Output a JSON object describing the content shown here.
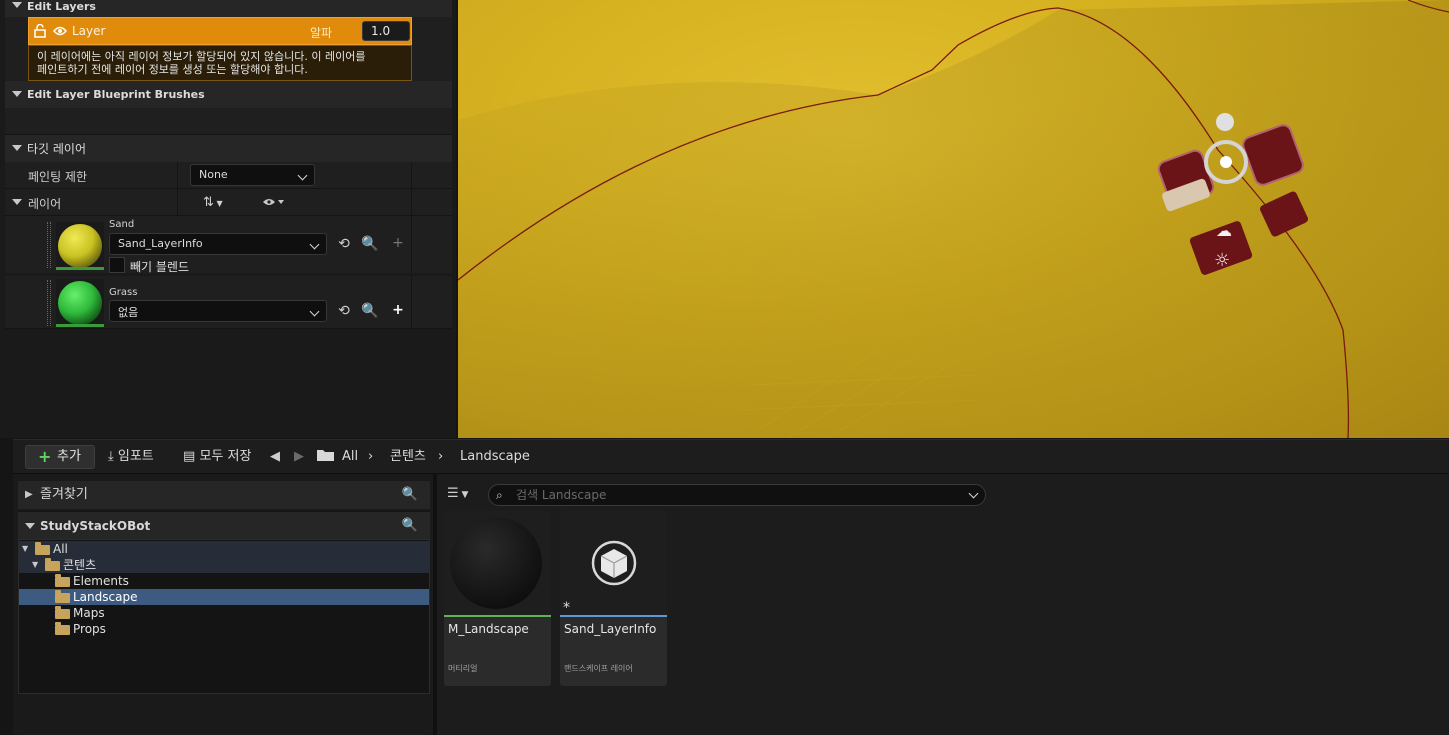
{
  "details": {
    "edit_layers_header": "Edit Layers",
    "layer_name": "Layer",
    "alpha_label": "알파",
    "alpha_value": "1.0",
    "warning_line1": "이 레이어에는 아직 레이어 정보가 할당되어 있지 않습니다. 이 레이어를",
    "warning_line2": "페인트하기 전에 레이어 정보를 생성 또는 할당해야 합니다.",
    "blueprint_brushes_header": "Edit Layer Blueprint Brushes",
    "target_layers_header": "타깃 레이어",
    "paint_restriction_label": "페인팅 제한",
    "paint_restriction_value": "None",
    "layers_label": "레이어",
    "layers": [
      {
        "name": "Sand",
        "info": "Sand_LayerInfo",
        "color": "#d4cc2a",
        "noise_blend_label": "빼기 블렌드"
      },
      {
        "name": "Grass",
        "info": "없음",
        "color": "#33c23f"
      }
    ]
  },
  "content_browser": {
    "add_label": "추가",
    "import_label": "임포트",
    "save_all_label": "모두 저장",
    "breadcrumb": [
      "All",
      "콘텐츠",
      "Landscape"
    ],
    "favorites_label": "즐겨찾기",
    "project_label": "StudyStackOBot",
    "tree": [
      {
        "label": "All",
        "depth": 0,
        "open": true
      },
      {
        "label": "콘텐츠",
        "depth": 1,
        "open": true
      },
      {
        "label": "Elements",
        "depth": 2
      },
      {
        "label": "Landscape",
        "depth": 2,
        "selected": true
      },
      {
        "label": "Maps",
        "depth": 2
      },
      {
        "label": "Props",
        "depth": 2
      }
    ],
    "search_placeholder": "검색 Landscape",
    "assets": [
      {
        "name": "M_Landscape",
        "type": "머티리얼",
        "accent": "#5ab552"
      },
      {
        "name": "Sand_LayerInfo",
        "type": "랜드스케이프 레이어",
        "accent": "#5b9bd5"
      }
    ]
  },
  "colors": {
    "accent_orange": "#e08b0b",
    "selection_blue": "#3d5a80",
    "terrain_yellow": "#d6b221"
  }
}
